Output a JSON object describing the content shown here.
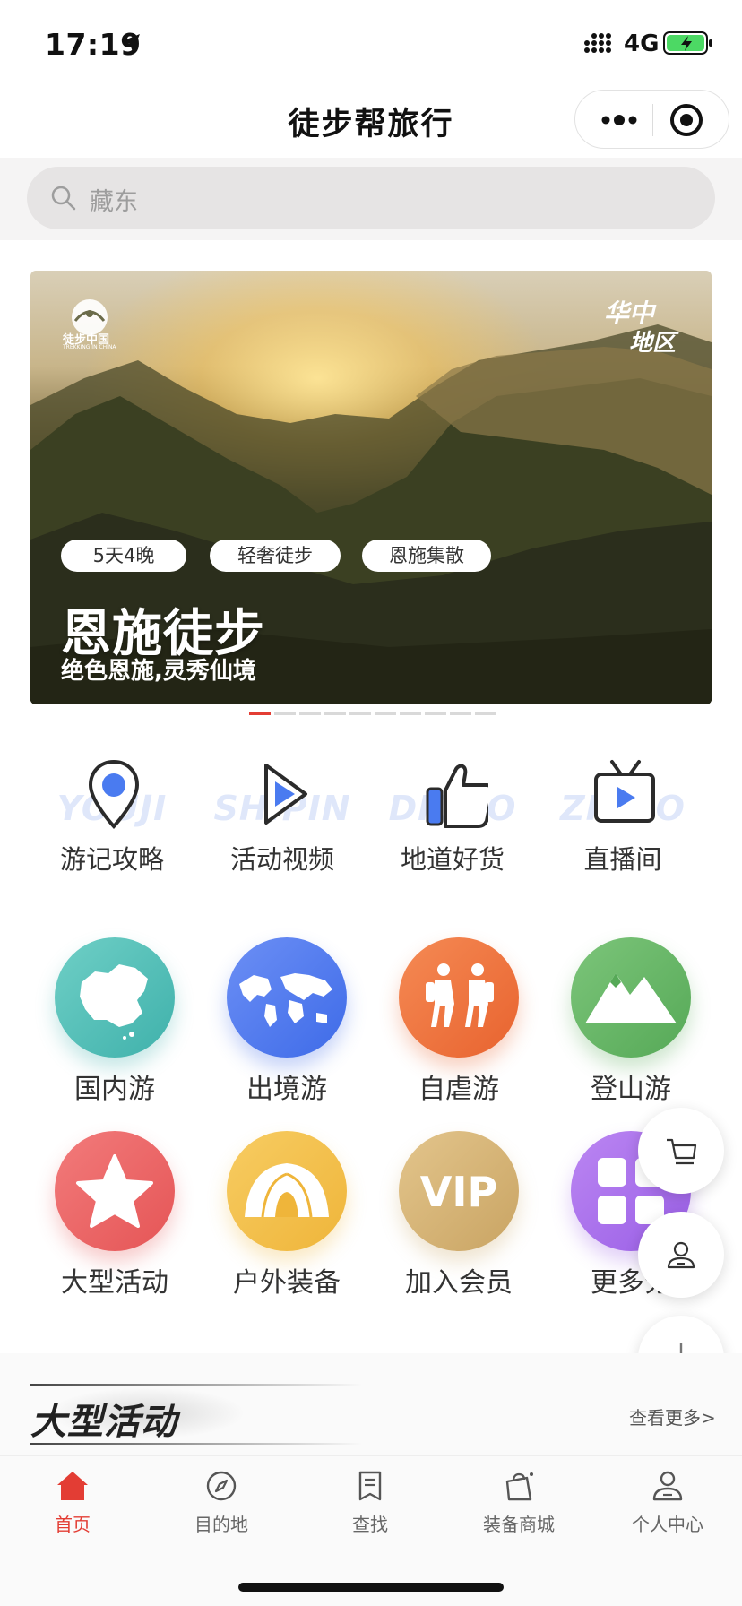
{
  "status": {
    "time": "17:19",
    "network": "4G"
  },
  "title_bar": {
    "title": "徒步帮旅行"
  },
  "search": {
    "placeholder": "藏东"
  },
  "banner": {
    "logo_text": "徒步中国",
    "logo_sub": "TREKKING IN CHINA",
    "region_line1": "华中",
    "region_line2": "地区",
    "tags": [
      "5天4晚",
      "轻奢徒步",
      "恩施集散"
    ],
    "title": "恩施徒步",
    "subtitle": "绝色恩施,灵秀仙境",
    "pages": 10,
    "active_page": 1
  },
  "quick_links": [
    {
      "watermark": "YOUJI",
      "label": "游记攻略",
      "icon": "location-pin-icon"
    },
    {
      "watermark": "SHIPIN",
      "label": "活动视频",
      "icon": "play-icon"
    },
    {
      "watermark": "DIDAO",
      "label": "地道好货",
      "icon": "thumbs-up-icon"
    },
    {
      "watermark": "ZHIBO",
      "label": "直播间",
      "icon": "tv-icon"
    }
  ],
  "grid_row1": [
    {
      "label": "国内游",
      "icon": "china-map-icon",
      "color": "#3fb1ab"
    },
    {
      "label": "出境游",
      "icon": "world-map-icon",
      "color": "#3e6be8"
    },
    {
      "label": "自虐游",
      "icon": "hikers-icon",
      "color": "#e8632f"
    },
    {
      "label": "登山游",
      "icon": "mountain-icon",
      "color": "#56a957"
    }
  ],
  "grid_row2": [
    {
      "label": "大型活动",
      "icon": "star-icon",
      "color": "#e55556"
    },
    {
      "label": "户外装备",
      "icon": "tent-icon",
      "color": "#efb53a"
    },
    {
      "label": "加入会员",
      "icon": "vip-icon",
      "text": "VIP",
      "color": "#c9a463"
    },
    {
      "label": "更多分",
      "icon": "grid-icon",
      "color": "#9a5fe6"
    }
  ],
  "floating": [
    "cart-icon",
    "user-icon",
    "plus-icon"
  ],
  "section": {
    "title": "大型活动",
    "see_more": "查看更多>"
  },
  "tab_bar": {
    "items": [
      {
        "label": "首页",
        "icon": "home-icon",
        "active": true
      },
      {
        "label": "目的地",
        "icon": "compass-icon",
        "active": false
      },
      {
        "label": "查找",
        "icon": "bookmark-icon",
        "active": false
      },
      {
        "label": "装备商城",
        "icon": "bag-icon",
        "active": false
      },
      {
        "label": "个人中心",
        "icon": "profile-icon",
        "active": false
      }
    ]
  },
  "colors": {
    "accent": "#e33d34",
    "text": "#333333",
    "search_bg": "#e6e4e4"
  }
}
